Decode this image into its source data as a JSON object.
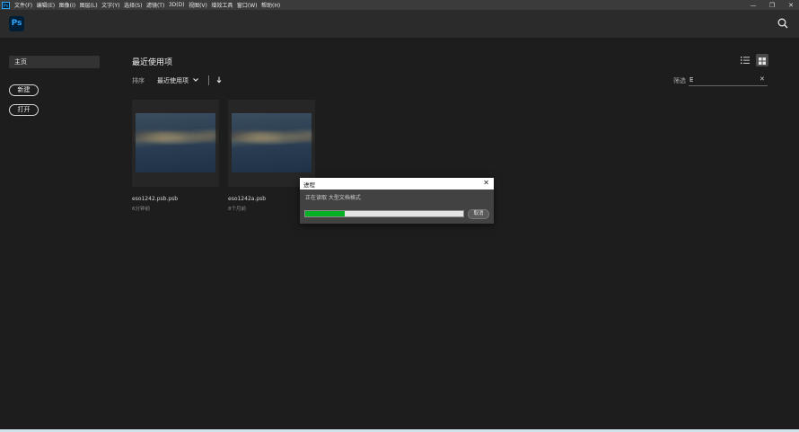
{
  "menubar": {
    "app_badge": "Ps",
    "items": [
      "文件(F)",
      "编辑(E)",
      "图像(I)",
      "图层(L)",
      "文字(Y)",
      "选择(S)",
      "滤镜(T)",
      "3D(D)",
      "视图(V)",
      "增效工具",
      "窗口(W)",
      "帮助(H)"
    ]
  },
  "header": {
    "logo": "Ps"
  },
  "sidebar": {
    "home_label": "主页",
    "new_label": "新建",
    "open_label": "打开"
  },
  "main": {
    "section_title": "最近使用项",
    "sort_label": "排序",
    "sort_value": "最近使用项",
    "filter_label": "筛选",
    "filter_value": "E",
    "files": [
      {
        "name": "eso1242.psb.psb",
        "time": "6分钟前"
      },
      {
        "name": "eso1242a.psb",
        "time": "8个月前"
      }
    ]
  },
  "dialog": {
    "title": "进程",
    "message": "正在读取 大型文档格式",
    "progress": 0.25,
    "cancel_label": "取消"
  },
  "colors": {
    "progress_green": "#06b025",
    "ps_blue": "#31a8ff",
    "ps_dark": "#001e36"
  }
}
